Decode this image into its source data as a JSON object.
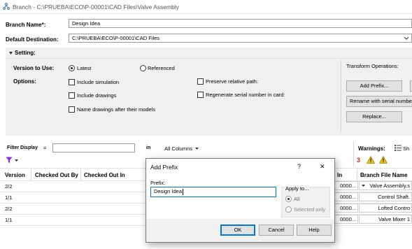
{
  "window": {
    "title": "Branch - C:\\PRUEBA\\ECO\\P-00001\\CAD Files\\Valve Assembly"
  },
  "form": {
    "branch_name_label": "Branch Name*:",
    "branch_name_value": "Design Idea",
    "default_destination_label": "Default Destination:",
    "default_destination_value": "C:\\PRUEBA\\ECO\\P-00001\\CAD Files"
  },
  "setting": {
    "header": "Setting:",
    "version_label": "Version to Use:",
    "version_latest": "Latest",
    "version_referenced": "Referenced",
    "options_label": "Options:",
    "include_simulation": "Include simulation",
    "include_drawings": "Include drawings",
    "name_drawings": "Name drawings after their models",
    "preserve_relative": "Preserve relative path:",
    "regenerate_serial": "Regenerate serial number in card:",
    "transform_label": "Transform Operations:",
    "add_prefix_button": "Add Prefix...",
    "rename_serial_button": "Rename with serial number",
    "replace_button": "Replace..."
  },
  "filter": {
    "label": "Filter Display",
    "equals": "=",
    "in_label": "in",
    "columns_value": "All Columns",
    "warnings_label": "Warnings:",
    "warnings_count": "3",
    "show_label": "Sh"
  },
  "grid": {
    "columns": [
      "Version",
      "Checked Out By",
      "Checked Out In",
      "In",
      "Branch File Name"
    ],
    "rows": [
      {
        "version": "2/2",
        "in_partial": "0000...",
        "file": "Valve Assembly.s",
        "expand": true
      },
      {
        "version": "1/1",
        "in_partial": "0000...",
        "file": "Control Shaft.",
        "expand": false
      },
      {
        "version": "2/2",
        "in_partial": "0000...",
        "file": "Lofted Contro",
        "expand": false
      },
      {
        "version": "1/1",
        "in_partial": "0000...",
        "file": "Valve Mixer 1",
        "expand": false
      }
    ]
  },
  "dialog": {
    "title": "Add Prefix",
    "help_glyph": "?",
    "close_glyph": "✕",
    "prefix_label": "Prefix:",
    "prefix_value": "Design Idea",
    "apply_label": "Apply to...",
    "apply_all": "All",
    "apply_selected": "Selected only",
    "ok_button": "OK",
    "cancel_button": "Cancel",
    "help_button": "Help"
  },
  "icons": {
    "app": "branch-icon",
    "filter": "funnel-icon",
    "warning": "warning-icon"
  },
  "colors": {
    "accent": "#0078d7",
    "warning_red": "#e02020",
    "filter_purple": "#8a2be2"
  }
}
